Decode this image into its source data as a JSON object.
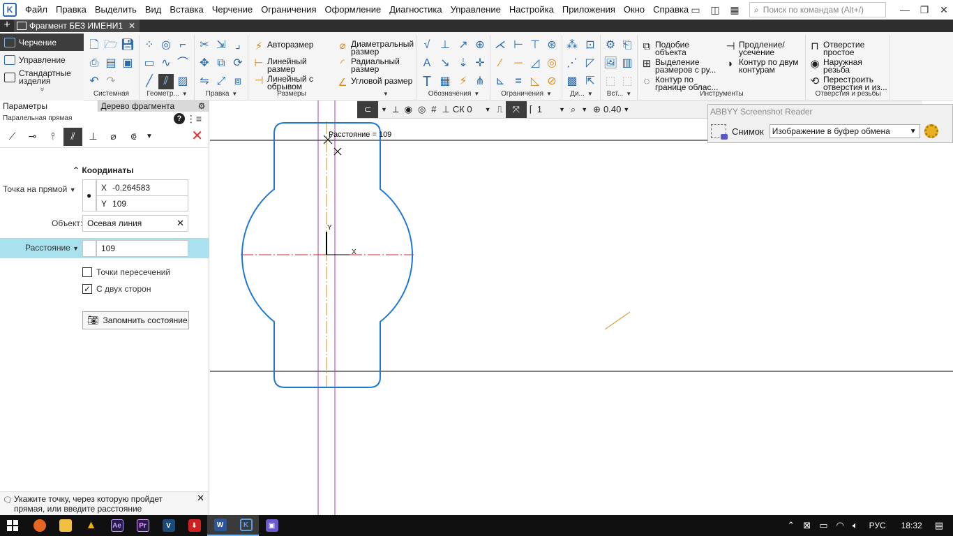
{
  "menu": {
    "items": [
      "Файл",
      "Правка",
      "Выделить",
      "Вид",
      "Вставка",
      "Черчение",
      "Ограничения",
      "Оформление",
      "Диагностика",
      "Управление",
      "Настройка",
      "Приложения",
      "Окно",
      "Справка"
    ],
    "search_placeholder": "Поиск по командам (Alt+/)"
  },
  "document_tab": {
    "title": "Фрагмент БЕЗ ИМЕНИ1",
    "close": "✕"
  },
  "modes": {
    "active": "Черчение",
    "second": "Управление",
    "third": "Стандартные изделия",
    "more": "»"
  },
  "ribbon": {
    "groups": {
      "system": "Системная",
      "geometry": "Геометр...",
      "edit": "Правка",
      "dimensions": "Размеры",
      "designations": "Обозначения",
      "constraints": "Ограничения",
      "di": "Ди...",
      "ins": "Вст...",
      "tools": "Инструменты",
      "holes": "Отверстия и резьбы"
    },
    "dimension_commands": {
      "auto": "Авторазмер",
      "linear": "Линейный размер",
      "linear_break": "Линейный с обрывом",
      "diameter": "Диаметральный размер",
      "radial": "Радиальный размер",
      "angular": "Угловой размер"
    },
    "tool_commands": {
      "similar": "Подобие объекта",
      "select_dims": "Выделение размеров с ру...",
      "contour_region": "Контур по границе облас...",
      "extend": "Продление/ усечение",
      "contour_two": "Контур по двум контурам"
    },
    "hole_commands": {
      "simple_hole": "Отверстие простое",
      "external_thread": "Наружная резьба",
      "rebuild": "Перестроить отверстия и из..."
    }
  },
  "params": {
    "tab_active": "Параметры",
    "tab_tree": "Дерево фрагмента",
    "subtitle": "Паралельная прямая",
    "help": "?",
    "close": "✕",
    "section_coords": "Координаты",
    "point_label": "Точка на прямой",
    "x_label": "X",
    "x_value": "-0.264583",
    "y_label": "Y",
    "y_value": "109",
    "object_label": "Объект:",
    "object_value": "Осевая линия",
    "distance_label": "Расстояние",
    "distance_value": "109",
    "intersection_label": "Точки пересечений",
    "intersection_checked": false,
    "both_sides_label": "С двух сторон",
    "both_sides_checked": true,
    "remember_label": "Запомнить состояние"
  },
  "hint": {
    "text": "Укажите точку, через которую пройдет прямая, или введите расстояние",
    "close": "✕"
  },
  "canvas_toolbar": {
    "cs": "СК 0",
    "layer": "1",
    "zoom": "0.40"
  },
  "canvas": {
    "dimension_label": "Расстояние = 109",
    "axis_x": "X",
    "axis_y": "Y",
    "colors": {
      "contour": "#1e78d4",
      "axis_center": "#c8282a",
      "axis_orange": "#e08a1e",
      "guide_purple": "#a13ca3",
      "aux_line": "#000000"
    }
  },
  "abbyy": {
    "title": "ABBYY Screenshot Reader",
    "snap_label": "Снимок",
    "mode_value": "Изображение в буфер обмена"
  },
  "taskbar": {
    "lang": "РУС",
    "time": "18:32"
  }
}
